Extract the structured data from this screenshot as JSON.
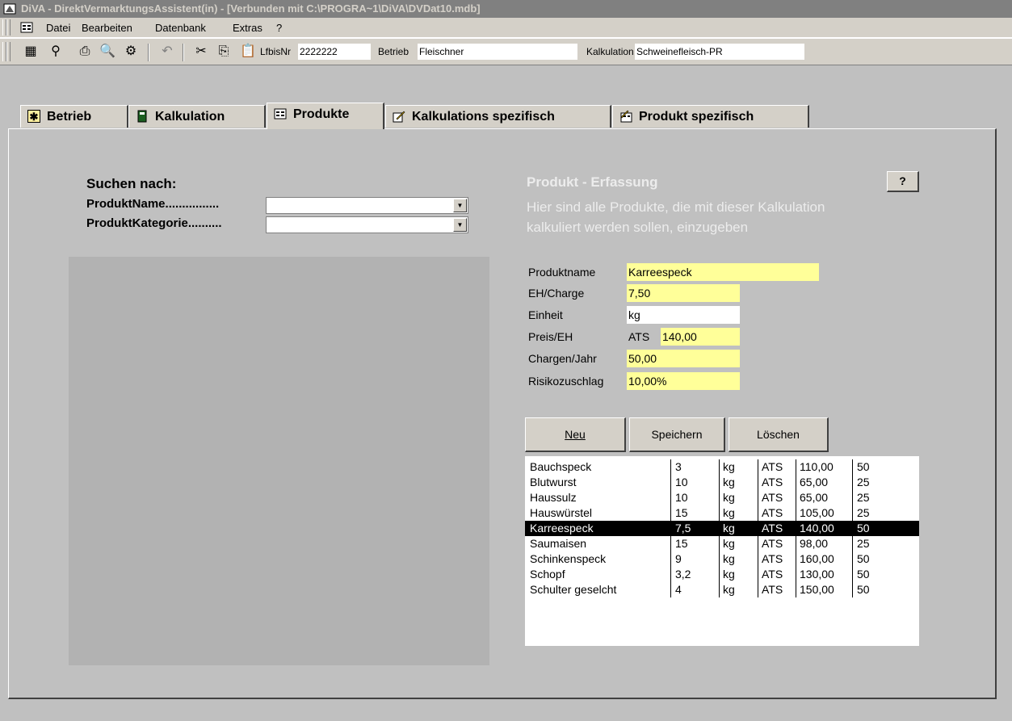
{
  "window": {
    "title": "DiVA - DirektVermarktungsAssistent(in) - [Verbunden mit C:\\PROGRA~1\\DiVA\\DVDat10.mdb]"
  },
  "menubar": {
    "items": [
      "Datei",
      "Bearbeiten",
      "Datenbank",
      "Extras",
      "?"
    ]
  },
  "toolbar": {
    "lfbisnr_label": "LfbisNr",
    "lfbisnr_value": "2222222",
    "betrieb_label": "Betrieb",
    "betrieb_value": "Fleischner",
    "kalkulation_label": "Kalkulation",
    "kalkulation_value": "Schweinefleisch-PR"
  },
  "tabs": [
    "Betrieb",
    "Kalkulation",
    "Produkte",
    "Kalkulations spezifisch",
    "Produkt spezifisch"
  ],
  "active_tab": "Produkte",
  "search": {
    "title": "Suchen nach:",
    "name_label": "ProduktName................",
    "name_value": "",
    "category_label": "ProduktKategorie..........",
    "category_value": ""
  },
  "form": {
    "heading": "Produkt - Erfassung",
    "description_line1": "Hier sind alle Produkte, die mit dieser Kalkulation",
    "description_line2": "kalkuliert werden sollen, einzugeben",
    "help_label": "?",
    "produktname_label": "Produktname",
    "produktname_value": "Karreespeck",
    "eh_charge_label": "EH/Charge",
    "eh_charge_value": "7,50",
    "einheit_label": "Einheit",
    "einheit_value": "kg",
    "preis_label": "Preis/EH",
    "preis_currency": "ATS",
    "preis_value": "140,00",
    "chargen_label": "Chargen/Jahr",
    "chargen_value": "50,00",
    "risiko_label": "Risikozuschlag",
    "risiko_value": "10,00%"
  },
  "buttons": {
    "neu": "Neu",
    "speichern": "Speichern",
    "loeschen": "Löschen"
  },
  "products": [
    [
      "Bauchspeck",
      "3",
      "kg",
      "ATS",
      "110,00",
      "50"
    ],
    [
      "Blutwurst",
      "10",
      "kg",
      "ATS",
      "65,00",
      "25"
    ],
    [
      "Haussulz",
      "10",
      "kg",
      "ATS",
      "65,00",
      "25"
    ],
    [
      "Hauswürstel",
      "15",
      "kg",
      "ATS",
      "105,00",
      "25"
    ],
    [
      "Karreespeck",
      "7,5",
      "kg",
      "ATS",
      "140,00",
      "50"
    ],
    [
      "Saumaisen",
      "15",
      "kg",
      "ATS",
      "98,00",
      "25"
    ],
    [
      "Schinkenspeck",
      "9",
      "kg",
      "ATS",
      "160,00",
      "50"
    ],
    [
      "Schopf",
      "3,2",
      "kg",
      "ATS",
      "130,00",
      "50"
    ],
    [
      "Schulter geselcht",
      "4",
      "kg",
      "ATS",
      "150,00",
      "50"
    ]
  ],
  "selected_product_index": 4,
  "colors": {
    "field_yellow": "#ffff99",
    "face": "#d4d0c8",
    "panel": "#c0c0c0",
    "list_bg": "#b2b2b2"
  }
}
